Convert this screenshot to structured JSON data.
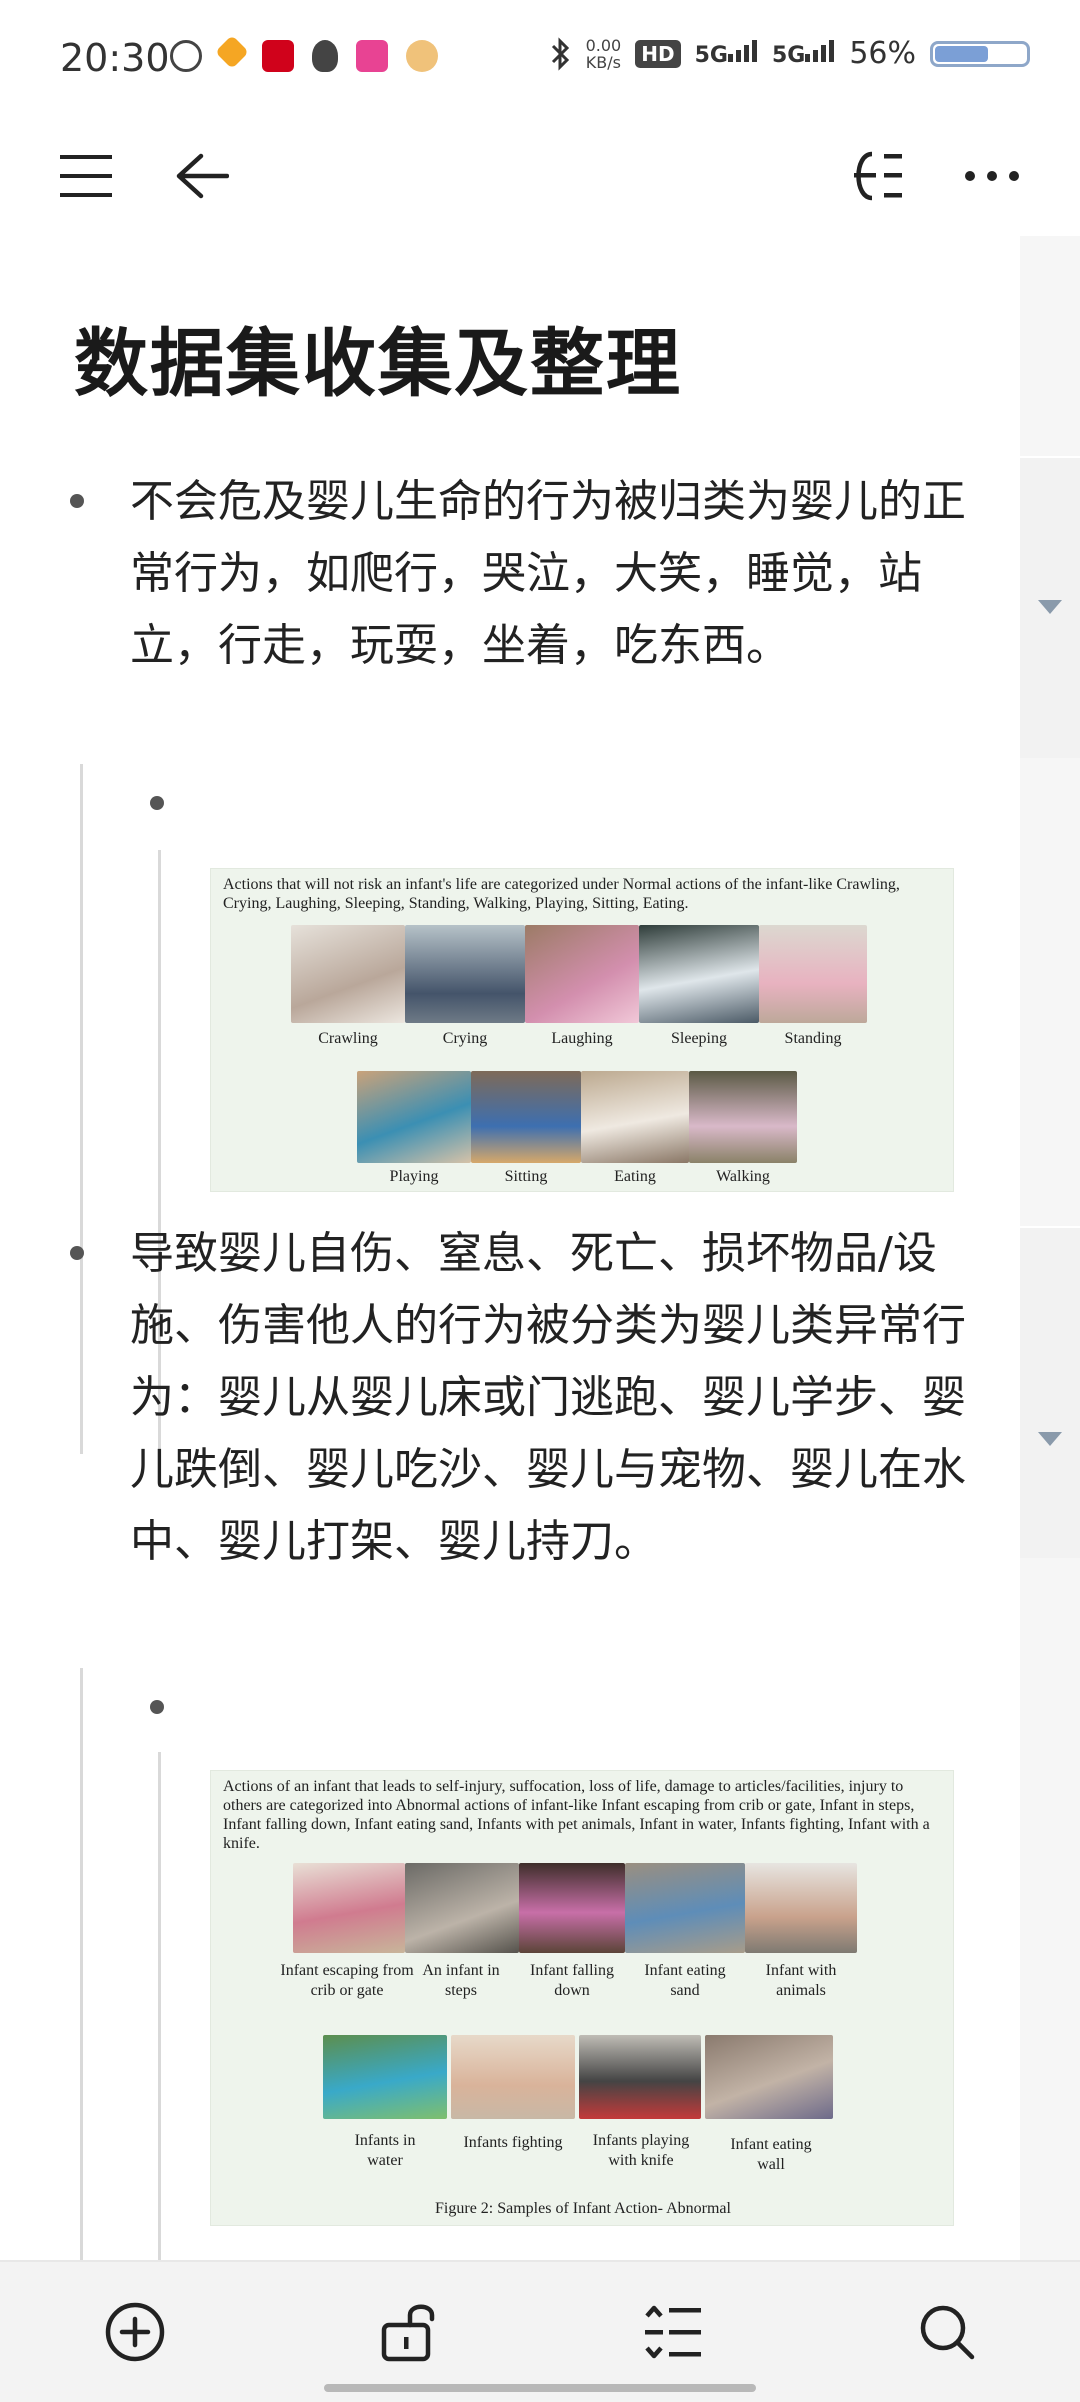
{
  "status_bar": {
    "time": "20:30",
    "net_speed_value": "0.00",
    "net_speed_unit": "KB/s",
    "hd_label": "HD",
    "signal1": "5G",
    "signal2": "5G",
    "battery_text": "56%",
    "battery_level": 0.56
  },
  "document": {
    "title": "数据集收集及整理",
    "paragraph1": "不会危及婴儿生命的行为被归类为婴儿的正常行为，如爬行，哭泣，大笑，睡觉，站立，行走，玩耍，坐着，吃东西。",
    "paragraph2": "导致婴儿自伤、窒息、死亡、损坏物品/设施、伤害他人的行为被分类为婴儿类异常行为：婴儿从婴儿床或门逃跑、婴儿学步、婴儿跌倒、婴儿吃沙、婴儿与宠物、婴儿在水中、婴儿打架、婴儿持刀。",
    "figure1": {
      "caption": "Actions that will not risk an infant's life are categorized under Normal actions of the infant-like Crawling, Crying, Laughing, Sleeping, Standing, Walking, Playing, Sitting, Eating.",
      "labels_row1": [
        "Crawling",
        "Crying",
        "Laughing",
        "Sleeping",
        "Standing"
      ],
      "labels_row2": [
        "Playing",
        "Sitting",
        "Eating",
        "Walking"
      ]
    },
    "figure2": {
      "caption": "Actions of an infant that leads to self-injury, suffocation, loss of life, damage to articles/facilities, injury to others are categorized into Abnormal actions of infant-like Infant escaping from crib or gate, Infant in steps, Infant falling down, Infant eating sand, Infants with pet animals, Infant in water, Infants fighting, Infant with a knife.",
      "labels_row1": [
        "Infant escaping from crib or gate",
        "An infant in steps",
        "Infant falling down",
        "Infant eating sand",
        "Infant with animals"
      ],
      "labels_row2": [
        "Infants in water",
        "Infants fighting",
        "Infants playing with knife",
        "Infant eating wall"
      ],
      "figure_label": "Figure 2: Samples of Infant Action- Abnormal"
    }
  },
  "colors": {
    "text": "#1a1a1a",
    "accent_battery": "#7b9fd6",
    "figure_bg": "#eef4ec"
  }
}
